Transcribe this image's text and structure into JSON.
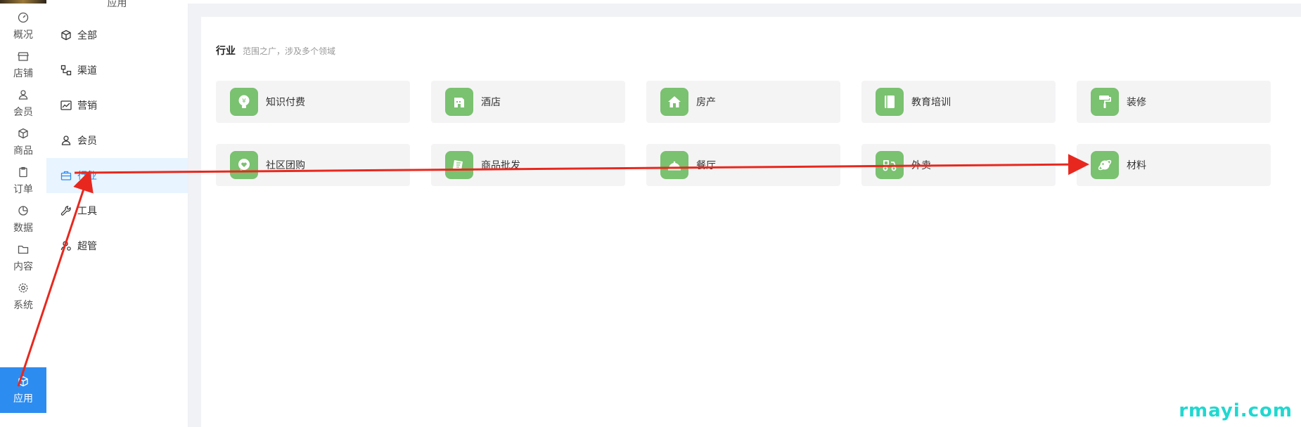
{
  "rail": {
    "items": [
      {
        "label": "概况",
        "icon": "dashboard-icon"
      },
      {
        "label": "店铺",
        "icon": "store-icon"
      },
      {
        "label": "会员",
        "icon": "user-icon"
      },
      {
        "label": "商品",
        "icon": "box-icon"
      },
      {
        "label": "订单",
        "icon": "clipboard-icon"
      },
      {
        "label": "数据",
        "icon": "pie-icon"
      },
      {
        "label": "内容",
        "icon": "folder-icon"
      },
      {
        "label": "系统",
        "icon": "gear-icon"
      },
      {
        "label": "应用",
        "icon": "cube-icon",
        "active": true
      }
    ]
  },
  "submenu": {
    "title": "应用",
    "items": [
      {
        "label": "全部",
        "icon": "cube-icon"
      },
      {
        "label": "渠道",
        "icon": "channel-icon"
      },
      {
        "label": "营销",
        "icon": "trend-icon"
      },
      {
        "label": "会员",
        "icon": "user-icon"
      },
      {
        "label": "行业",
        "icon": "briefcase-icon",
        "active": true
      },
      {
        "label": "工具",
        "icon": "wrench-icon"
      },
      {
        "label": "超管",
        "icon": "admin-icon"
      }
    ]
  },
  "main": {
    "title": "行业",
    "subtitle": "范围之广，涉及多个领域",
    "tiles": [
      {
        "label": "知识付费",
        "icon": "yen-bulb-icon"
      },
      {
        "label": "酒店",
        "icon": "hotel-icon"
      },
      {
        "label": "房产",
        "icon": "house-icon"
      },
      {
        "label": "教育培训",
        "icon": "book-icon"
      },
      {
        "label": "装修",
        "icon": "paint-roller-icon"
      },
      {
        "label": "社区团购",
        "icon": "heart-bubble-icon"
      },
      {
        "label": "商品批发",
        "icon": "wholesale-icon"
      },
      {
        "label": "餐厅",
        "icon": "cloche-icon"
      },
      {
        "label": "外卖",
        "icon": "delivery-icon"
      },
      {
        "label": "材料",
        "icon": "planet-icon"
      }
    ]
  },
  "colors": {
    "accent": "#2d8cf0",
    "tile_icon": "#7ac170",
    "annotation": "#e8281e",
    "watermark": "#20d8d0"
  },
  "watermark": "rmayi.com"
}
